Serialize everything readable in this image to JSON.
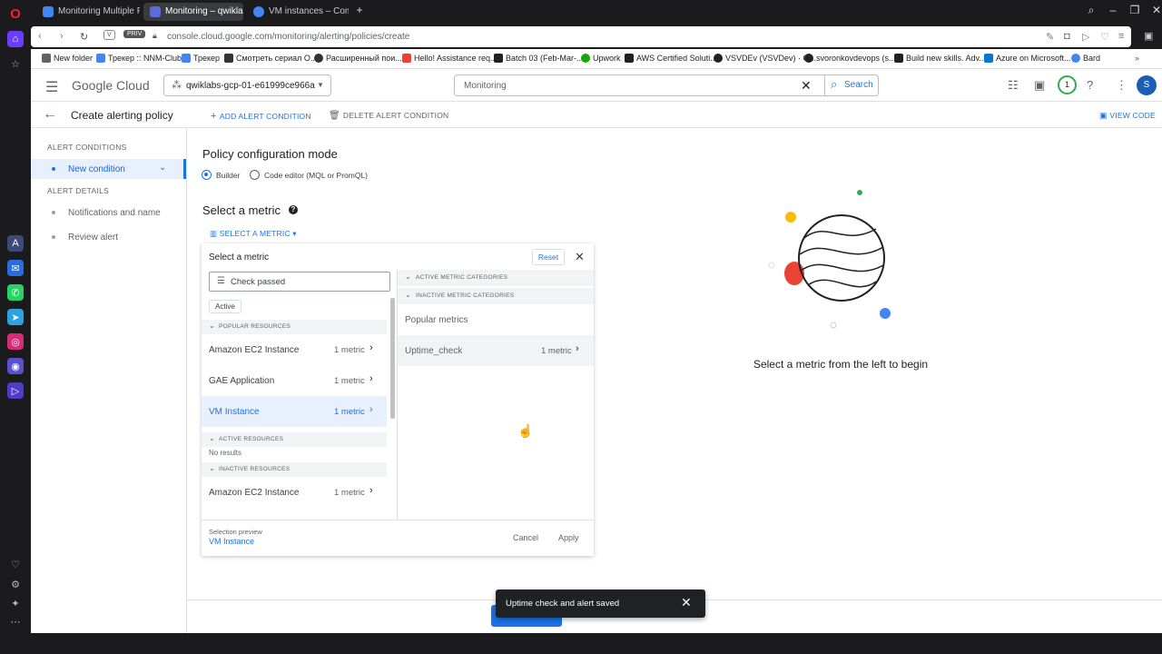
{
  "browser": {
    "tabs": [
      {
        "label": "Monitoring Multiple Proje",
        "color": "#4285f4"
      },
      {
        "label": "Monitoring – qwiklabs-gcp",
        "color": "#5b6bdb"
      },
      {
        "label": "VM instances – Compute",
        "color": "#4285f4"
      }
    ],
    "new_tab_icon": "plus-icon",
    "address": "console.cloud.google.com/monitoring/alerting/policies/create",
    "badge_v": "V",
    "badge_priv": "PRIV",
    "bookmarks": [
      {
        "label": "New folder",
        "color": "#5f6368"
      },
      {
        "label": "Трекер :: NNM-Club",
        "color": "#4285f4"
      },
      {
        "label": "Трекер",
        "color": "#4285f4"
      },
      {
        "label": "Смотреть сериал О...",
        "color": "#333333"
      },
      {
        "label": "Расширенный пои...",
        "color": "#333333"
      },
      {
        "label": "Hello! Assistance req...",
        "color": "#ea4335"
      },
      {
        "label": "Batch 03 (Feb-Mar-...",
        "color": "#202124"
      },
      {
        "label": "Upwork",
        "color": "#14a800"
      },
      {
        "label": "AWS Certified Soluti...",
        "color": "#202124"
      },
      {
        "label": "VSVDEv (VSVDev) · G...",
        "color": "#202124"
      },
      {
        "label": "svoronkovdevops (s...",
        "color": "#202124"
      },
      {
        "label": "Build new skills. Adv...",
        "color": "#202124"
      },
      {
        "label": "Azure on Microsoft...",
        "color": "#0078d4"
      },
      {
        "label": "Bard",
        "color": "#4285f4"
      }
    ]
  },
  "header": {
    "logo": "Google Cloud",
    "project": "qwiklabs-gcp-01-e61999ce966a",
    "search_value": "Monitoring",
    "search_button": "Search",
    "notification_count": "1",
    "avatar_letter": "S"
  },
  "subheader": {
    "title": "Create alerting policy",
    "add_condition": "ADD ALERT CONDITION",
    "delete_condition": "DELETE ALERT CONDITION",
    "view_code": "VIEW CODE"
  },
  "leftnav": {
    "section1": "ALERT CONDITIONS",
    "new_condition": "New condition",
    "section2": "ALERT DETAILS",
    "notifications": "Notifications and name",
    "review": "Review alert"
  },
  "main": {
    "mode_heading": "Policy configuration mode",
    "builder": "Builder",
    "code_editor": "Code editor (MQL or PromQL)",
    "metric_heading": "Select a metric",
    "select_metric_btn": "SELECT A METRIC",
    "empty_state": "Select a metric from the left to begin"
  },
  "metric_panel": {
    "title": "Select a metric",
    "reset": "Reset",
    "filter_value": "Check passed",
    "chip": "Active",
    "popular_resources": "POPULAR RESOURCES",
    "active_resources": "ACTIVE RESOURCES",
    "inactive_resources": "INACTIVE RESOURCES",
    "no_results": "No results",
    "resources": [
      {
        "name": "Amazon EC2 Instance",
        "count": "1 metric"
      },
      {
        "name": "GAE Application",
        "count": "1 metric"
      },
      {
        "name": "VM Instance",
        "count": "1 metric"
      }
    ],
    "inactive": [
      {
        "name": "Amazon EC2 Instance",
        "count": "1 metric"
      }
    ],
    "active_categories": "ACTIVE METRIC CATEGORIES",
    "inactive_categories": "INACTIVE METRIC CATEGORIES",
    "popular_metrics": "Popular metrics",
    "uptime_name": "Uptime_check",
    "uptime_count": "1 metric",
    "selection_preview_label": "Selection preview",
    "selection_preview_value": "VM Instance",
    "cancel": "Cancel",
    "apply": "Apply"
  },
  "toast": {
    "message": "Uptime check and alert saved"
  },
  "colors": {
    "accent": "#1a73e8",
    "selected_bg": "#e8f0fe",
    "toast_bg": "#202124"
  }
}
